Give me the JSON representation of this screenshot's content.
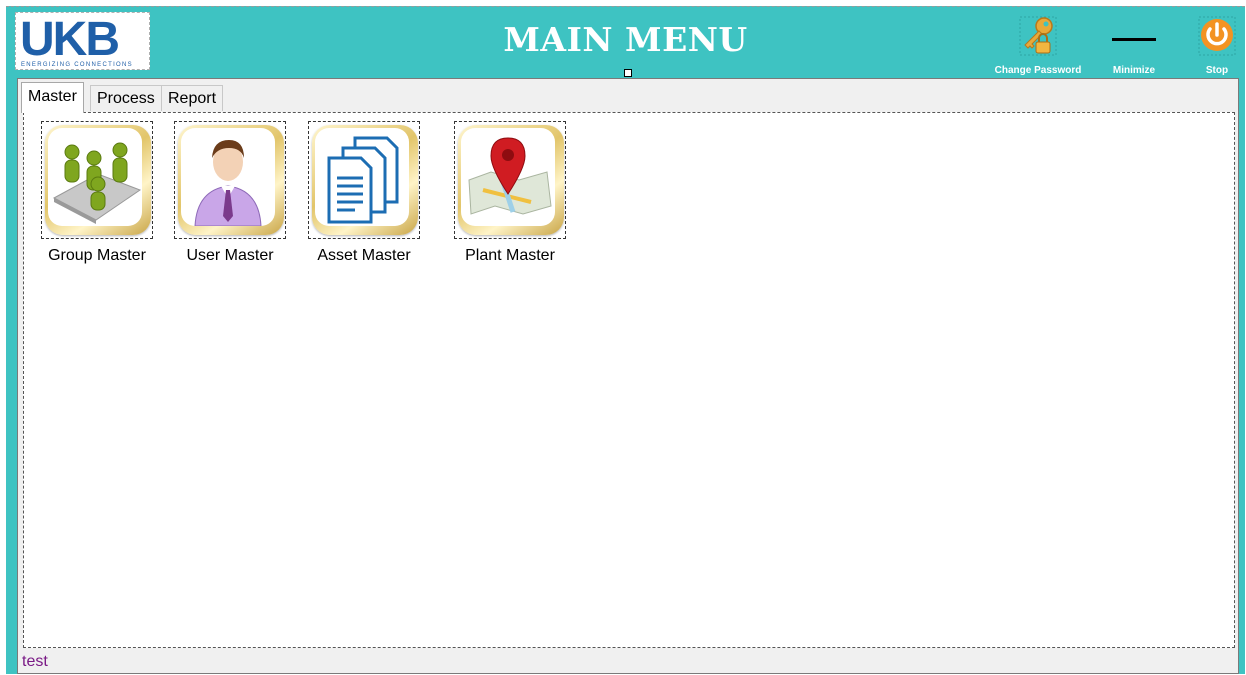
{
  "header": {
    "logo_text": "UKB",
    "logo_tagline": "ENERGIZING CONNECTIONS",
    "title": "MAIN MENU",
    "buttons": {
      "change_password": "Change Password",
      "minimize": "Minimize",
      "stop": "Stop"
    }
  },
  "tabs": [
    {
      "label": "Master",
      "active": true
    },
    {
      "label": "Process",
      "active": false
    },
    {
      "label": "Report",
      "active": false
    }
  ],
  "tiles": [
    {
      "label": "Group Master",
      "icon": "group-people-icon"
    },
    {
      "label": "User Master",
      "icon": "user-person-icon"
    },
    {
      "label": "Asset Master",
      "icon": "documents-icon"
    },
    {
      "label": "Plant Master",
      "icon": "map-pin-icon"
    }
  ],
  "status": {
    "text": "test"
  },
  "colors": {
    "header_bg": "#3ec3c2",
    "logo_blue": "#1f5fa8",
    "stop_orange": "#f39322",
    "status_text": "#7a1a86"
  }
}
